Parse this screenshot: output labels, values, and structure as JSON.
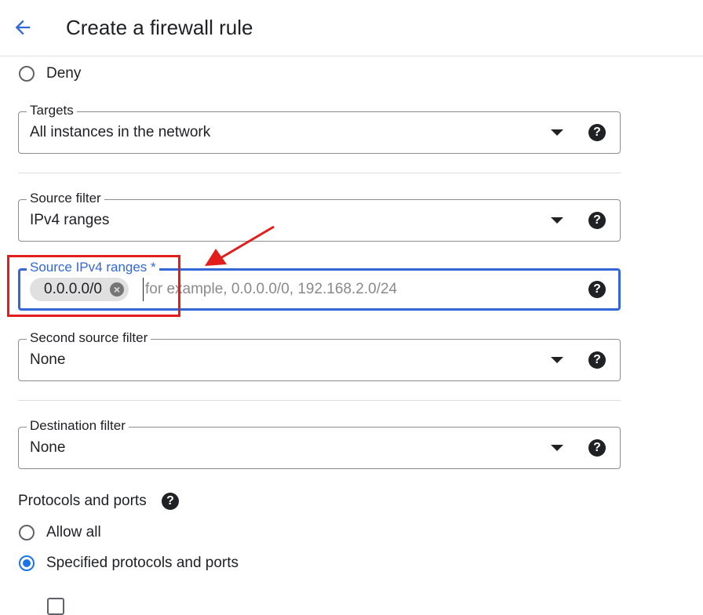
{
  "header": {
    "title": "Create a firewall rule",
    "back_icon": "arrow-left-icon"
  },
  "action": {
    "deny_label": "Deny"
  },
  "targets": {
    "label": "Targets",
    "value": "All instances in the network"
  },
  "source_filter": {
    "label": "Source filter",
    "value": "IPv4 ranges"
  },
  "source_ranges": {
    "label": "Source IPv4 ranges *",
    "chip": "0.0.0.0/0",
    "placeholder": "for example, 0.0.0.0/0, 192.168.2.0/24"
  },
  "second_source_filter": {
    "label": "Second source filter",
    "value": "None"
  },
  "destination_filter": {
    "label": "Destination filter",
    "value": "None"
  },
  "protocols": {
    "title": "Protocols and ports",
    "options": [
      {
        "label": "Allow all",
        "selected": false
      },
      {
        "label": "Specified protocols and ports",
        "selected": true
      }
    ]
  },
  "colors": {
    "accent": "#3367d6",
    "annotation": "#e31c1c"
  },
  "icons": {
    "help": "help-circle-icon",
    "dropdown": "dropdown-arrow-icon",
    "chip_remove": "remove-chip-icon"
  }
}
